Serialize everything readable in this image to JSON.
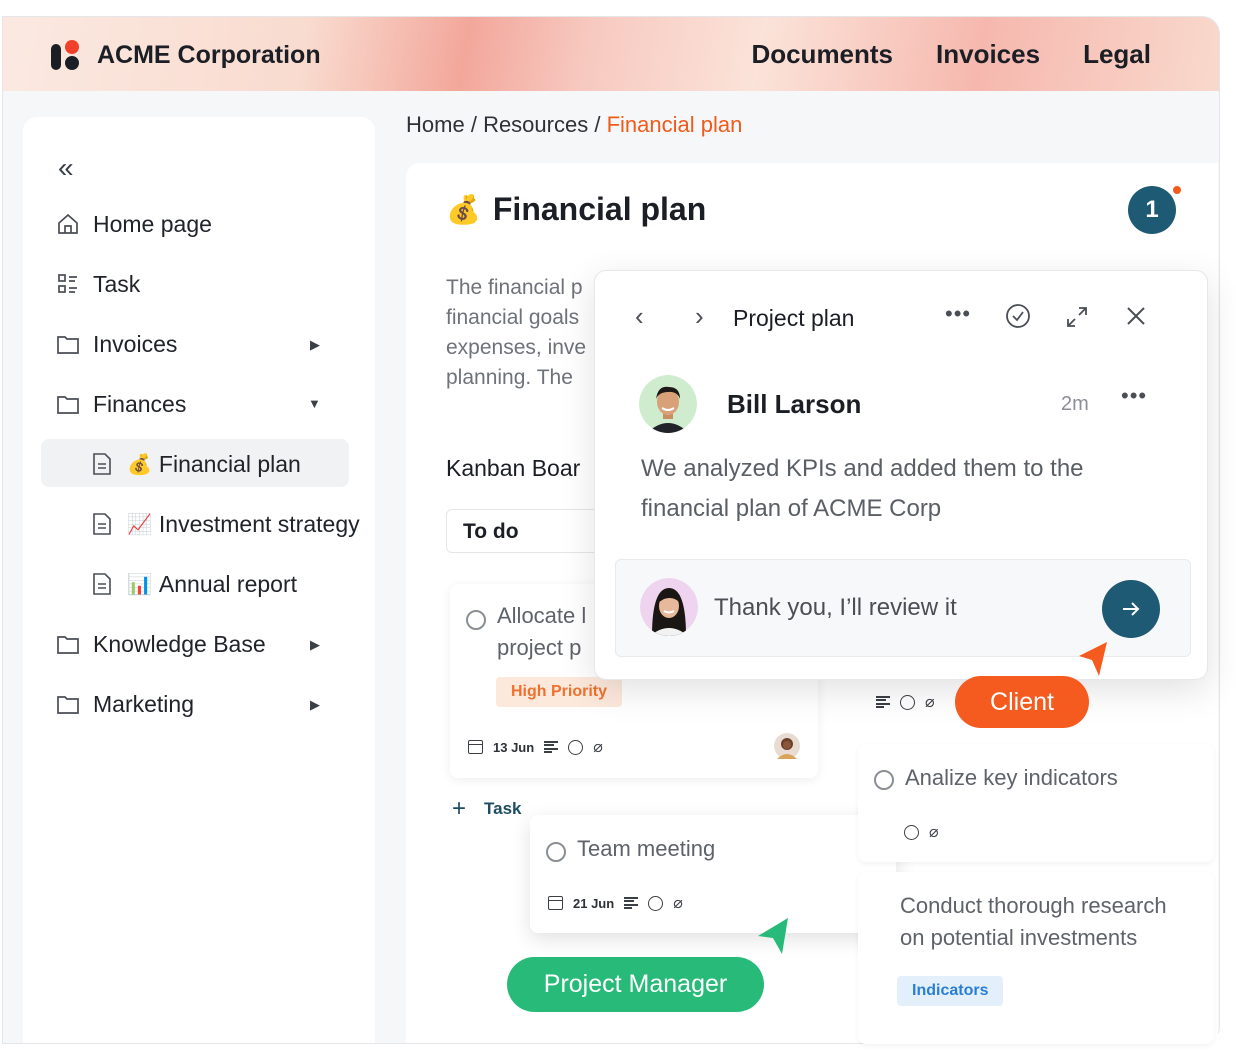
{
  "header": {
    "brand": "ACME Corporation",
    "nav": [
      "Documents",
      "Invoices",
      "Legal"
    ]
  },
  "sidebar": {
    "collapse_icon": "double-chevron-left-icon",
    "items": [
      {
        "label": "Home page",
        "icon": "home-icon"
      },
      {
        "label": "Task",
        "icon": "task-list-icon"
      },
      {
        "label": "Invoices",
        "icon": "folder-icon",
        "caret": "right"
      },
      {
        "label": "Finances",
        "icon": "folder-icon",
        "caret": "down"
      },
      {
        "label": "Financial plan",
        "emoji": "💰",
        "icon": "document-icon",
        "active": true
      },
      {
        "label": "Investment strategy",
        "emoji": "📈",
        "icon": "document-icon"
      },
      {
        "label": "Annual report",
        "emoji": "📊",
        "icon": "document-icon"
      },
      {
        "label": "Knowledge Base",
        "icon": "folder-icon",
        "caret": "right"
      },
      {
        "label": "Marketing",
        "icon": "folder-icon",
        "caret": "right"
      }
    ]
  },
  "breadcrumb": {
    "home": "Home",
    "sep": "/",
    "section": "Resources",
    "current": "Financial plan"
  },
  "doc": {
    "emoji": "💰",
    "title": "Financial plan",
    "notification_count": "1",
    "para_lines": [
      "The financial p",
      "financial goals",
      "expenses, inve",
      "planning. The"
    ],
    "kanban_title": "Kanban Boar",
    "column": "To do",
    "cards": {
      "c1": {
        "title_l1": "Allocate l",
        "title_l2": "project p",
        "tag": "High Priority",
        "date": "13 Jun"
      },
      "c2": {
        "title": "Team meeting",
        "date": "21 Jun"
      },
      "c3": {
        "title": "Analize key indicators"
      },
      "c4": {
        "title_l1": "Conduct thorough research",
        "title_l2": "on potential investments",
        "tag": "Indicators"
      }
    },
    "add_task": "Task"
  },
  "popup": {
    "title": "Project plan",
    "author": "Bill Larson",
    "time": "2m",
    "comment": "We analyzed KPIs and added them to the financial plan of ACME Corp",
    "reply": "Thank you, I’ll review it"
  },
  "labels": {
    "client": "Client",
    "pm": "Project Manager"
  },
  "colors": {
    "accent": "#f05a1a",
    "primary": "#1e5a73",
    "green": "#27ba78"
  }
}
